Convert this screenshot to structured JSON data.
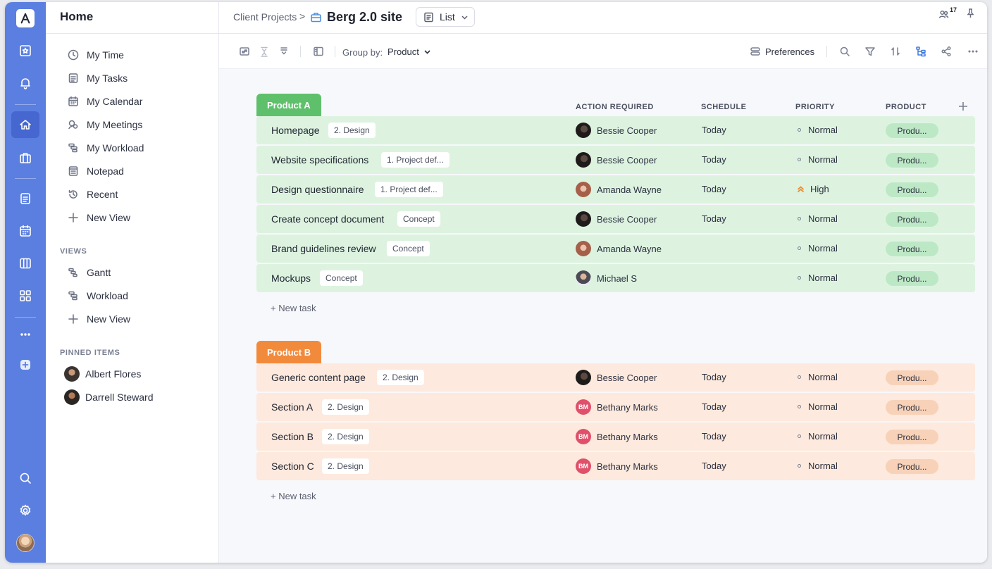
{
  "colors": {
    "rail": "#5b7fe0",
    "group_a": "#5fc06c",
    "group_b": "#f28a3c",
    "row_a": "#ddf3e0",
    "row_b": "#fde9dd",
    "accent": "#3d7be0"
  },
  "rail": {
    "icons": [
      "logo-icon",
      "star-calendar-icon",
      "bell-icon",
      "home-icon",
      "briefcase-icon",
      "document-icon",
      "calendar-icon",
      "board-icon",
      "grid-icon",
      "more-icon",
      "add-icon",
      "search-icon",
      "gear-icon"
    ]
  },
  "sidebar": {
    "title": "Home",
    "items": [
      {
        "label": "My Time",
        "icon": "clock-icon"
      },
      {
        "label": "My Tasks",
        "icon": "tasks-icon"
      },
      {
        "label": "My Calendar",
        "icon": "calendar-icon"
      },
      {
        "label": "My Meetings",
        "icon": "meetings-icon"
      },
      {
        "label": "My Workload",
        "icon": "workload-icon"
      },
      {
        "label": "Notepad",
        "icon": "notepad-icon"
      },
      {
        "label": "Recent",
        "icon": "history-icon"
      },
      {
        "label": "New View",
        "icon": "plus-icon"
      }
    ],
    "views_title": "VIEWS",
    "views": [
      {
        "label": "Gantt",
        "icon": "gantt-icon"
      },
      {
        "label": "Workload",
        "icon": "workload-icon"
      },
      {
        "label": "New View",
        "icon": "plus-icon"
      }
    ],
    "pinned_title": "PINNED ITEMS",
    "pinned": [
      {
        "label": "Albert Flores"
      },
      {
        "label": "Darrell Steward"
      }
    ]
  },
  "topbar": {
    "breadcrumb": "Client Projects",
    "separator": ">",
    "project": "Berg 2.0 site",
    "view": "List",
    "members_count": "17"
  },
  "toolbar": {
    "group_by_label": "Group by:",
    "group_by_value": "Product",
    "preferences": "Preferences"
  },
  "columns": {
    "action": "ACTION REQUIRED",
    "schedule": "SCHEDULE",
    "priority": "PRIORITY",
    "product": "PRODUCT"
  },
  "groups": [
    {
      "name": "Product A",
      "new_task": "+ New task",
      "rows": [
        {
          "name": "Homepage",
          "tag": "2. Design",
          "person": "Bessie Cooper",
          "avatar": "bessie",
          "schedule": "Today",
          "priority": "Normal",
          "product": "Produ..."
        },
        {
          "name": "Website specifications",
          "tag": "1. Project def...",
          "person": "Bessie Cooper",
          "avatar": "bessie",
          "schedule": "Today",
          "priority": "Normal",
          "product": "Produ..."
        },
        {
          "name": "Design questionnaire",
          "tag": "1. Project def...",
          "person": "Amanda Wayne",
          "avatar": "amanda",
          "schedule": "Today",
          "priority": "High",
          "product": "Produ..."
        },
        {
          "name": "Create concept document",
          "tag": "Concept",
          "person": "Bessie Cooper",
          "avatar": "bessie",
          "schedule": "Today",
          "priority": "Normal",
          "product": "Produ..."
        },
        {
          "name": "Brand guidelines review",
          "tag": "Concept",
          "person": "Amanda Wayne",
          "avatar": "amanda",
          "schedule": "",
          "priority": "Normal",
          "product": "Produ..."
        },
        {
          "name": "Mockups",
          "tag": "Concept",
          "person": "Michael S",
          "avatar": "michael",
          "schedule": "",
          "priority": "Normal",
          "product": "Produ..."
        }
      ]
    },
    {
      "name": "Product B",
      "new_task": "+ New task",
      "rows": [
        {
          "name": "Generic content page",
          "tag": "2. Design",
          "person": "Bessie Cooper",
          "avatar": "bessie",
          "schedule": "Today",
          "priority": "Normal",
          "product": "Produ..."
        },
        {
          "name": "Section A",
          "tag": "2. Design",
          "person": "Bethany Marks",
          "avatar": "bm",
          "initials": "BM",
          "schedule": "Today",
          "priority": "Normal",
          "product": "Produ..."
        },
        {
          "name": "Section B",
          "tag": "2. Design",
          "person": "Bethany Marks",
          "avatar": "bm",
          "initials": "BM",
          "schedule": "Today",
          "priority": "Normal",
          "product": "Produ..."
        },
        {
          "name": "Section C",
          "tag": "2. Design",
          "person": "Bethany Marks",
          "avatar": "bm",
          "initials": "BM",
          "schedule": "Today",
          "priority": "Normal",
          "product": "Produ..."
        }
      ]
    }
  ]
}
